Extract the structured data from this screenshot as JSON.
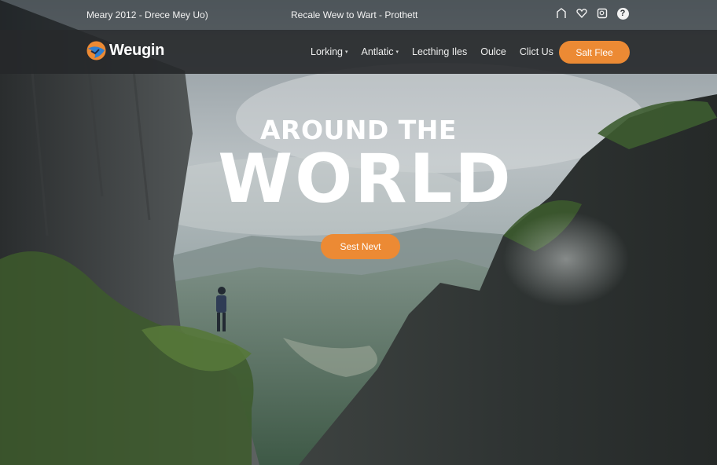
{
  "topbar": {
    "left_text": "Meary 2012 - Drece Mey Uo)",
    "center_text": "Recale Wew to Wart - Prothett",
    "icons": [
      "home-icon",
      "heart-icon",
      "search-icon",
      "help-icon"
    ],
    "help_glyph": "?"
  },
  "brand": {
    "name": "Weugin",
    "colors": {
      "accent": "#ec8a34",
      "logo_blue": "#2f7fd1"
    }
  },
  "nav": {
    "items": [
      {
        "label": "Lorking",
        "dropdown": true
      },
      {
        "label": "Antlatic",
        "dropdown": true
      },
      {
        "label": "Lecthing Iles",
        "dropdown": false
      },
      {
        "label": "Oulce",
        "dropdown": false
      },
      {
        "label": "Clict Us",
        "dropdown": false
      }
    ],
    "caret": "▾",
    "cta_label": "Salt Flee"
  },
  "hero": {
    "subtitle": "AROUND THE",
    "title": "WORLD",
    "button_label": "Sest Nevt"
  }
}
